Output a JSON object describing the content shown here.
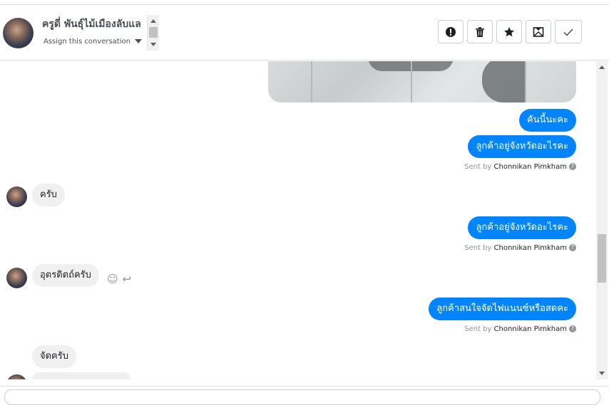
{
  "header": {
    "name": "ครูดี่ พันธุ์ไม้เมืองลับแล",
    "assign": "Assign this conversation",
    "actions": [
      {
        "name": "mark-spam-button",
        "icon": "exclamation-icon"
      },
      {
        "name": "delete-button",
        "icon": "trash-icon"
      },
      {
        "name": "star-button",
        "icon": "star-icon"
      },
      {
        "name": "mark-unread-button",
        "icon": "envelope-icon"
      },
      {
        "name": "mark-done-button",
        "icon": "check-icon"
      }
    ]
  },
  "messages": {
    "out1": "คันนี้นะคะ",
    "out2": "ลูกค้าอยู่จังหวัดอะไรคะ",
    "in1": "ครับ",
    "out3": "ลูกค้าอยู่จังหวัดอะไรคะ",
    "in2": "อุตรดิตถ์ครับ",
    "out4": "ลูกค้าสนใจจัดไฟแนนซ์หรือสดคะ",
    "in3": "จัดครับ"
  },
  "sentby": {
    "prefix": "Sent by",
    "agent": "Chonnikan Pimkham",
    "help": "?"
  },
  "colors": {
    "outgoing": "#0084ff",
    "incoming": "#f1f0f0"
  }
}
